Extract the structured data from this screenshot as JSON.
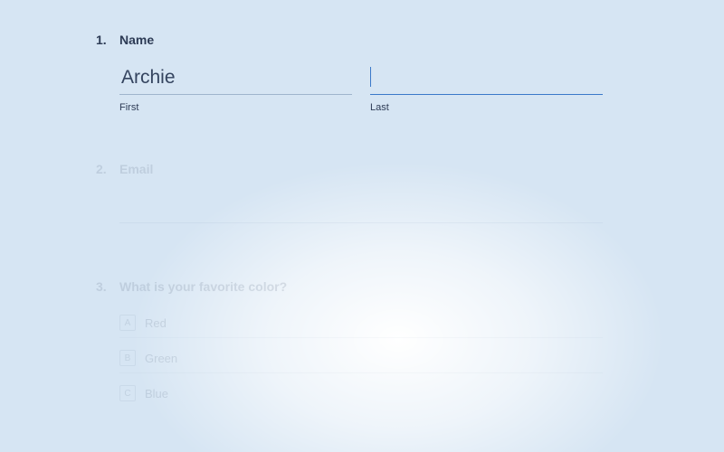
{
  "questions": [
    {
      "number": "1.",
      "label": "Name",
      "fields": {
        "first": {
          "value": "Archie",
          "sublabel": "First"
        },
        "last": {
          "value": "",
          "sublabel": "Last"
        }
      }
    },
    {
      "number": "2.",
      "label": "Email",
      "value": ""
    },
    {
      "number": "3.",
      "label": "What is your favorite color?",
      "options": [
        {
          "key": "A",
          "label": "Red"
        },
        {
          "key": "B",
          "label": "Green"
        },
        {
          "key": "C",
          "label": "Blue"
        }
      ]
    }
  ]
}
